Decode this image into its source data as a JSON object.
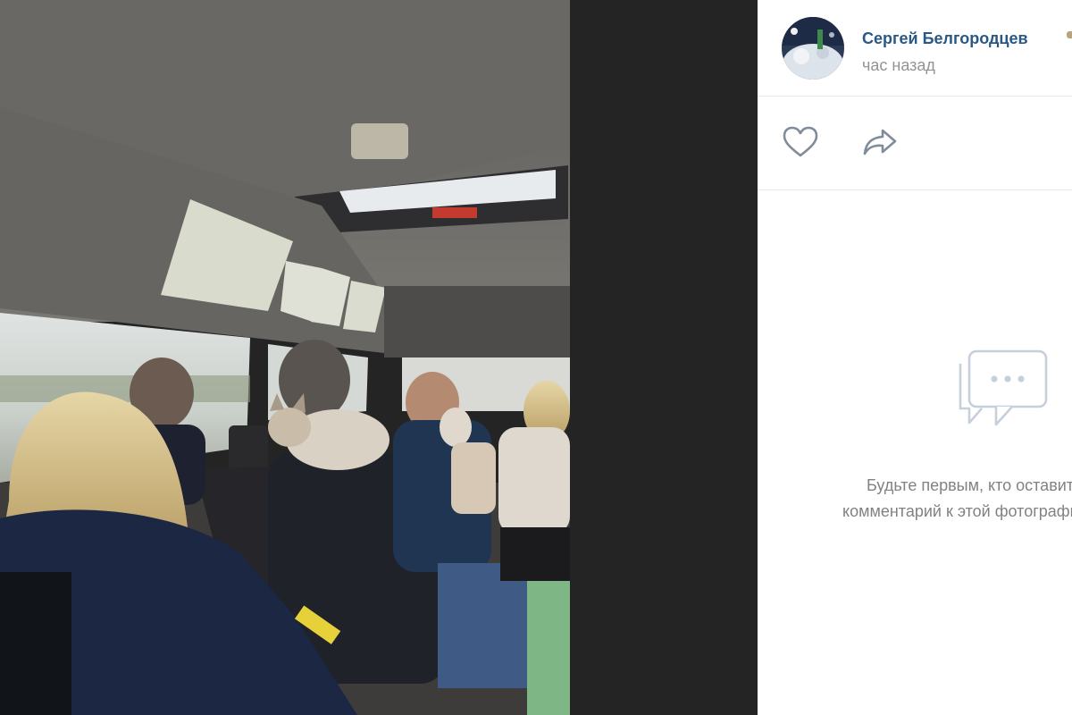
{
  "author": {
    "name": "Сергей Белгородцев",
    "time": "час назад"
  },
  "actions": {
    "like_icon": "heart-icon",
    "share_icon": "share-arrow-icon"
  },
  "comments": {
    "empty_icon": "chat-bubbles-icon",
    "empty_line1": "Будьте первым, кто оставит",
    "empty_line2": "комментарий к этой фотографии"
  },
  "colors": {
    "author_link": "#2a5885",
    "muted_text": "#939393",
    "icon": "#818c99",
    "divider": "#e7e8ec",
    "viewer_background": "#242424"
  }
}
